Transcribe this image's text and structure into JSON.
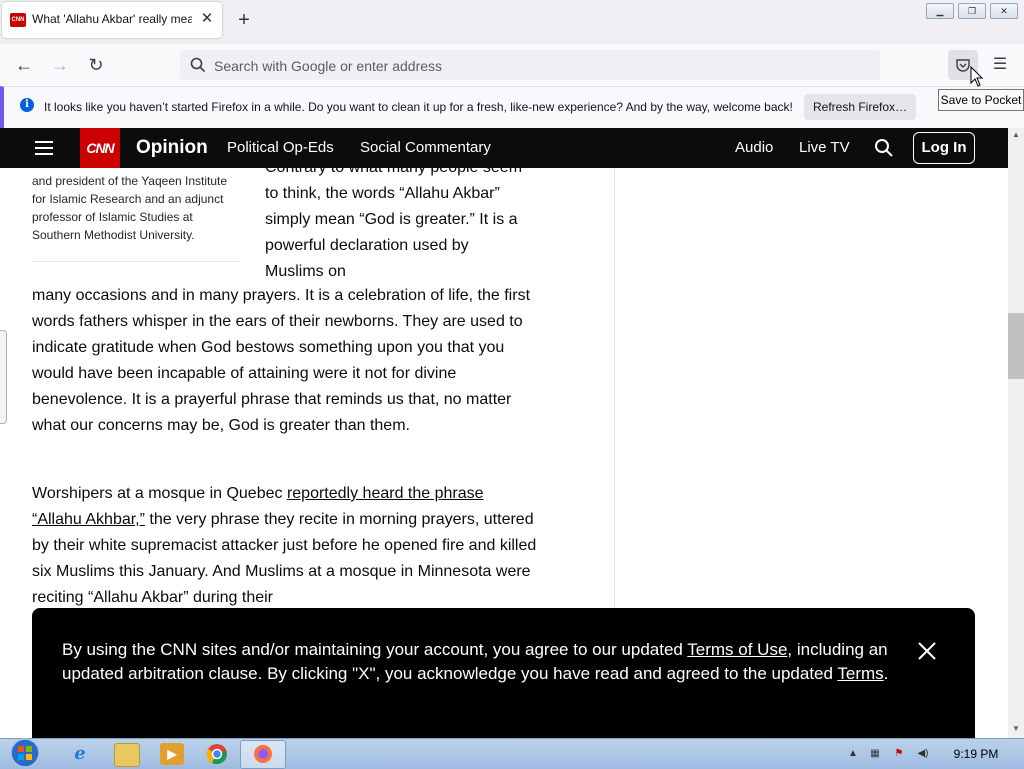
{
  "browser": {
    "tab_title": "What 'Allahu Akbar' really mean",
    "tab_favicon": "CNN",
    "new_tab_icon": "+",
    "url_placeholder": "Search with Google or enter address",
    "tooltip": "Save to Pocket",
    "notification": {
      "text": "It looks like you haven’t started Firefox in a while. Do you want to clean it up for a fresh, like-new experience? And by the way, welcome back!",
      "button": "Refresh Firefox…"
    }
  },
  "cnn": {
    "logo": "CNN",
    "section": "Opinion",
    "nav": [
      "Political Op-Eds",
      "Social Commentary",
      "Audio",
      "Live TV"
    ],
    "login": "Log In"
  },
  "article": {
    "bio": "and president of the Yaqeen Institute for Islamic Research and an adjunct professor of Islamic Studies at Southern Methodist University.",
    "p1_top": "Contrary to what many people seem to think, the words “Allahu Akbar” simply mean “God is greater.” It is a powerful declaration used by Muslims on",
    "p1_rest": "many occasions and in many prayers. It is a celebration of life, the first words fathers whisper in the ears of their newborns. They are used to indicate gratitude when God bestows something upon you that you would have been incapable of attaining were it not for divine benevolence. It is a prayerful phrase that reminds us that, no matter what our concerns may be, God is greater than them.",
    "p2_a": "Worshipers at a mosque in Quebec ",
    "p2_link": "reportedly heard the phrase “Allahu Akhbar,”",
    "p2_b": " the very phrase they recite in morning prayers, uttered by their white supremacist attacker just before he opened fire and killed six Muslims this January. And Muslims at a mosque in Minnesota were reciting “Allahu Akbar” during their"
  },
  "banner": {
    "t1": "By using the CNN sites and/or maintaining your account, you agree to our updated ",
    "link1": "Terms of Use",
    "t2": ", including an updated arbitration clause. By clicking \"X\", you acknowledge you have read and agreed to the updated ",
    "link2": "Terms",
    "t3": "."
  },
  "taskbar": {
    "clock": "9:19 PM"
  },
  "colors": {
    "cnn_red": "#cc0000",
    "cnn_bar": "#0c0c0c",
    "notif_accent": "#6c5ce7"
  }
}
